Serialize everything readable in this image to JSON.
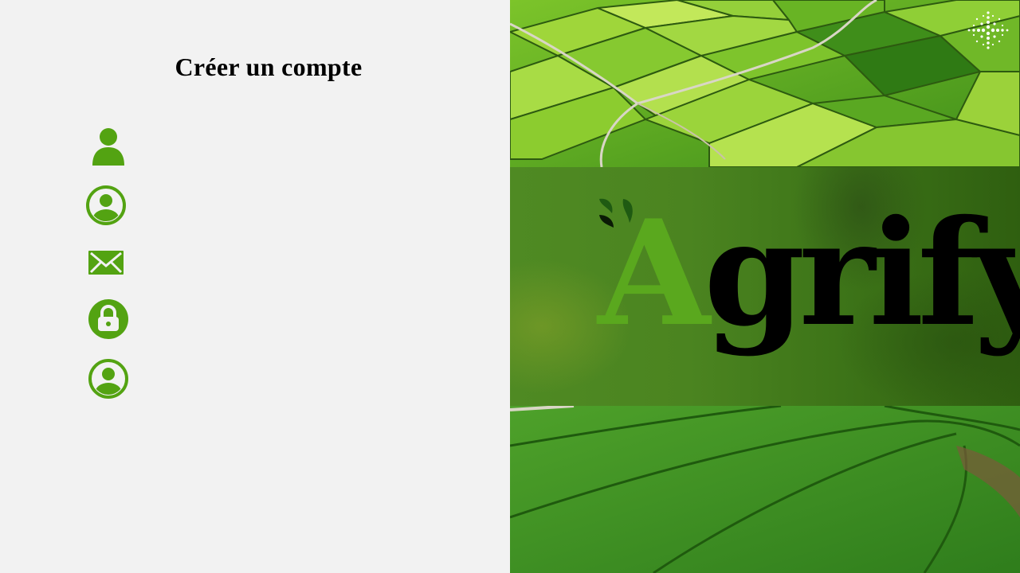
{
  "form": {
    "title": "Créer un compte",
    "fields": [
      {
        "icon": "person-icon",
        "value": "",
        "placeholder": ""
      },
      {
        "icon": "user-circle-icon",
        "value": "",
        "placeholder": ""
      },
      {
        "icon": "envelope-icon",
        "value": "",
        "placeholder": ""
      },
      {
        "icon": "lock-icon",
        "value": "",
        "placeholder": ""
      },
      {
        "icon": "user-circle-icon",
        "value": "",
        "placeholder": ""
      }
    ]
  },
  "brand": {
    "first_letter": "A",
    "rest": "grify"
  },
  "colors": {
    "accent": "#53a312",
    "background": "#f2f2f2",
    "logo_green": "#5aa81e"
  }
}
